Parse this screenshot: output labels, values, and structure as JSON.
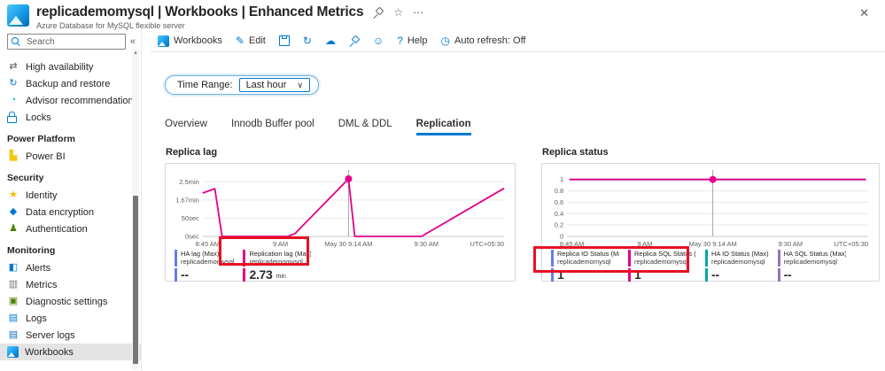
{
  "header": {
    "title": "replicademomysql | Workbooks | Enhanced Metrics",
    "subtitle": "Azure Database for MySQL flexible server"
  },
  "icons": {
    "collapse": "«",
    "scroll_up": "▲",
    "chevron_down": "∨",
    "close": "✕",
    "star": "☆",
    "more": "⋯"
  },
  "sidebar": {
    "search_placeholder": "Search",
    "items": [
      {
        "kind": "item",
        "label": "High availability",
        "icon": "high-availability-icon",
        "glyph": "⇄",
        "color": "#605e5c"
      },
      {
        "kind": "item",
        "label": "Backup and restore",
        "icon": "backup-restore-icon",
        "glyph": "↻",
        "color": "#0078d4"
      },
      {
        "kind": "item",
        "label": "Advisor recommendations",
        "icon": "advisor-recommendations-icon",
        "glyph": "◔",
        "color": "#00b7c3"
      },
      {
        "kind": "item",
        "label": "Locks",
        "icon": "lock-icon",
        "special": "lock"
      },
      {
        "kind": "section",
        "label": "Power Platform"
      },
      {
        "kind": "item",
        "label": "Power BI",
        "icon": "power-bi-icon",
        "glyph": "▙",
        "color": "#f2c811"
      },
      {
        "kind": "section",
        "label": "Security"
      },
      {
        "kind": "item",
        "label": "Identity",
        "icon": "identity-icon",
        "glyph": "★",
        "color": "#ffb900"
      },
      {
        "kind": "item",
        "label": "Data encryption",
        "icon": "data-encryption-icon",
        "glyph": "◆",
        "color": "#0078d4"
      },
      {
        "kind": "item",
        "label": "Authentication",
        "icon": "authentication-icon",
        "glyph": "♟",
        "color": "#498205"
      },
      {
        "kind": "section",
        "label": "Monitoring"
      },
      {
        "kind": "item",
        "label": "Alerts",
        "icon": "alerts-icon",
        "glyph": "◧",
        "color": "#0078d4"
      },
      {
        "kind": "item",
        "label": "Metrics",
        "icon": "metrics-icon",
        "glyph": "▥",
        "color": "#7a7574"
      },
      {
        "kind": "item",
        "label": "Diagnostic settings",
        "icon": "diagnostic-settings-icon",
        "glyph": "▣",
        "color": "#498205"
      },
      {
        "kind": "item",
        "label": "Logs",
        "icon": "logs-icon",
        "glyph": "▤",
        "color": "#0078d4"
      },
      {
        "kind": "item",
        "label": "Server logs",
        "icon": "server-logs-icon",
        "glyph": "▤",
        "color": "#106ebe"
      },
      {
        "kind": "item",
        "label": "Workbooks",
        "icon": "workbooks-icon",
        "special": "workbook",
        "selected": true
      }
    ]
  },
  "toolbar": {
    "items": [
      {
        "label": "Workbooks",
        "icon": "workbooks-icon",
        "special": "workbook"
      },
      {
        "label": "Edit",
        "icon": "edit-pencil-icon",
        "glyph": "✎"
      },
      {
        "label": "",
        "icon": "save-icon",
        "special": "save"
      },
      {
        "label": "",
        "icon": "refresh-icon",
        "glyph": "↻"
      },
      {
        "label": "",
        "icon": "cloud-icon",
        "glyph": "☁"
      },
      {
        "label": "",
        "icon": "pin-icon",
        "special": "pin"
      },
      {
        "label": "",
        "icon": "feedback-smiley-icon",
        "glyph": "☺"
      },
      {
        "label": "Help",
        "icon": "help-icon",
        "glyph": "?"
      },
      {
        "label": "Auto refresh: Off",
        "icon": "auto-refresh-clock-icon",
        "glyph": "◷"
      }
    ]
  },
  "filters": {
    "time_range_label": "Time Range:",
    "time_range_value": "Last hour"
  },
  "tabs": [
    {
      "label": "Overview",
      "active": false
    },
    {
      "label": "Innodb Buffer pool",
      "active": false
    },
    {
      "label": "DML & DDL",
      "active": false
    },
    {
      "label": "Replication",
      "active": true
    }
  ],
  "chart_data": [
    {
      "type": "line",
      "title": "Replica lag",
      "x_domain": [
        0,
        62
      ],
      "x_unit": "minutes since 8:44 AM",
      "y_domain": [
        0,
        175
      ],
      "y_unit": "seconds",
      "grid": true,
      "y_ticks": [
        {
          "value": 150,
          "label": "2.5min"
        },
        {
          "value": 100,
          "label": "1.67min"
        },
        {
          "value": 50,
          "label": "50sec"
        },
        {
          "value": 0,
          "label": "0sec"
        }
      ],
      "x_ticks": [
        {
          "value": 1,
          "label": "8:45 AM"
        },
        {
          "value": 16,
          "label": "9 AM"
        },
        {
          "value": 30,
          "label": "May 30 9:14 AM",
          "gridline": true
        },
        {
          "value": 46,
          "label": "9:30 AM"
        }
      ],
      "x_right_label": "UTC+05:30",
      "series": [
        {
          "name": "Replication lag (Max)",
          "color": "#e3008c",
          "points": [
            [
              0,
              119
            ],
            [
              2.5,
              131
            ],
            [
              4,
              0
            ],
            [
              17.5,
              0
            ],
            [
              19,
              8
            ],
            [
              30,
              158
            ],
            [
              31.3,
              0
            ],
            [
              45,
              0
            ],
            [
              62,
              132
            ]
          ],
          "marker": [
            30,
            158
          ]
        }
      ],
      "legend": [
        {
          "name": "HA lag (Max)",
          "resource": "replicademomysql",
          "value": "--",
          "unit": "",
          "color": "#637cef",
          "highlighted": false
        },
        {
          "name": "Replication lag (Max)",
          "resource": "replicademomysql",
          "value": "2.73",
          "unit": "min",
          "color": "#e3008c",
          "highlighted": true
        }
      ]
    },
    {
      "type": "line",
      "title": "Replica status",
      "x_domain": [
        0,
        62
      ],
      "x_unit": "minutes since 8:44 AM",
      "y_domain": [
        0,
        1.12
      ],
      "y_unit": "status",
      "grid": true,
      "y_ticks": [
        {
          "value": 1,
          "label": "1"
        },
        {
          "value": 0.8,
          "label": "0.8"
        },
        {
          "value": 0.6,
          "label": "0.6"
        },
        {
          "value": 0.4,
          "label": "0.4"
        },
        {
          "value": 0.2,
          "label": "0.2"
        },
        {
          "value": 0,
          "label": "0"
        }
      ],
      "x_ticks": [
        {
          "value": 1,
          "label": "8:45 AM"
        },
        {
          "value": 16,
          "label": "9 AM"
        },
        {
          "value": 30,
          "label": "May 30 9:14 AM",
          "gridline": true
        },
        {
          "value": 46,
          "label": "9:30 AM"
        }
      ],
      "x_right_label": "UTC+05:30",
      "series": [
        {
          "name": "Replica IO Status (Max)",
          "color": "#637cef",
          "points": [
            [
              0.5,
              1
            ],
            [
              61.5,
              1
            ]
          ]
        },
        {
          "name": "Replica SQL Status (Max)",
          "color": "#e3008c",
          "points": [
            [
              0.5,
              1
            ],
            [
              61.5,
              1
            ]
          ],
          "marker": [
            30,
            1
          ]
        }
      ],
      "legend": [
        {
          "name": "Replica IO Status (Max)",
          "resource": "replicademomysql",
          "value": "1",
          "unit": "",
          "color": "#637cef",
          "highlighted": true
        },
        {
          "name": "Replica SQL Status (...",
          "resource": "replicademomysql",
          "value": "1",
          "unit": "",
          "color": "#e3008c",
          "highlighted": true
        },
        {
          "name": "HA IO Status (Max)",
          "resource": "replicademomysql",
          "value": "--",
          "unit": "",
          "color": "#00a5af",
          "highlighted": false
        },
        {
          "name": "HA SQL Status (Max)",
          "resource": "replicademomysql",
          "value": "--",
          "unit": "",
          "color": "#9373c0",
          "highlighted": false
        }
      ]
    }
  ]
}
